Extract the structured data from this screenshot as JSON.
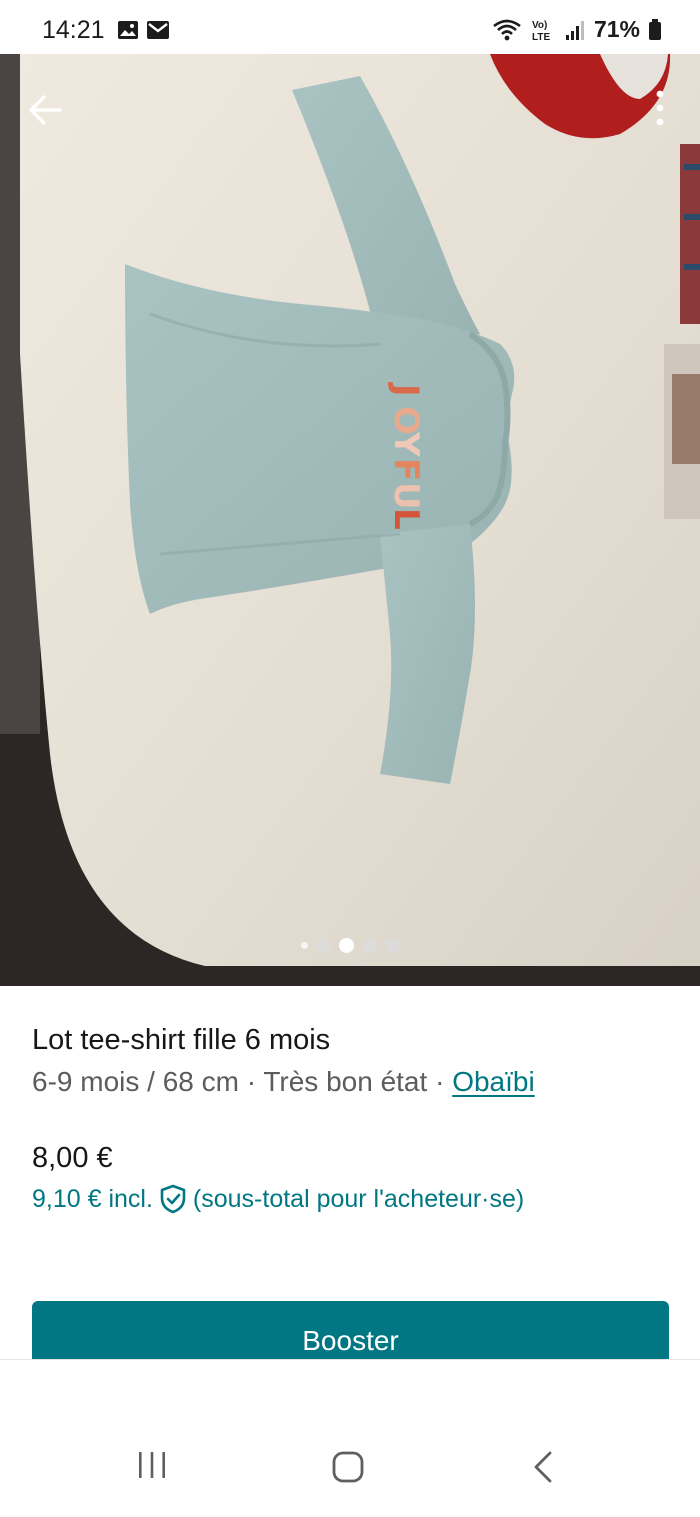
{
  "status_bar": {
    "time": "14:21",
    "battery": "71%",
    "left_icons": [
      "gallery-icon",
      "mail-icon"
    ],
    "right_icons": [
      "wifi-icon",
      "volte-icon",
      "signal-icon",
      "battery-icon"
    ]
  },
  "photo": {
    "description_icons": [
      "back-arrow-icon",
      "more-vertical-icon"
    ],
    "carousel": {
      "total": 5,
      "active_index": 2
    }
  },
  "listing": {
    "title": "Lot tee-shirt fille 6 mois",
    "size": "6-9 mois / 68 cm",
    "separator1": " · ",
    "condition": "Très bon état",
    "separator2": " · ",
    "brand": "Obaïbi",
    "price": "8,00 €",
    "price_incl_amount": "9,10 € incl.",
    "price_incl_note": "(sous-total pour l'acheteur·se)"
  },
  "actions": {
    "booster_label": "Booster"
  },
  "colors": {
    "accent": "#007782",
    "text_primary": "#171717",
    "text_secondary": "#5c5c5c"
  },
  "nav": {
    "icons": [
      "recents-icon",
      "home-icon",
      "back-icon"
    ]
  }
}
